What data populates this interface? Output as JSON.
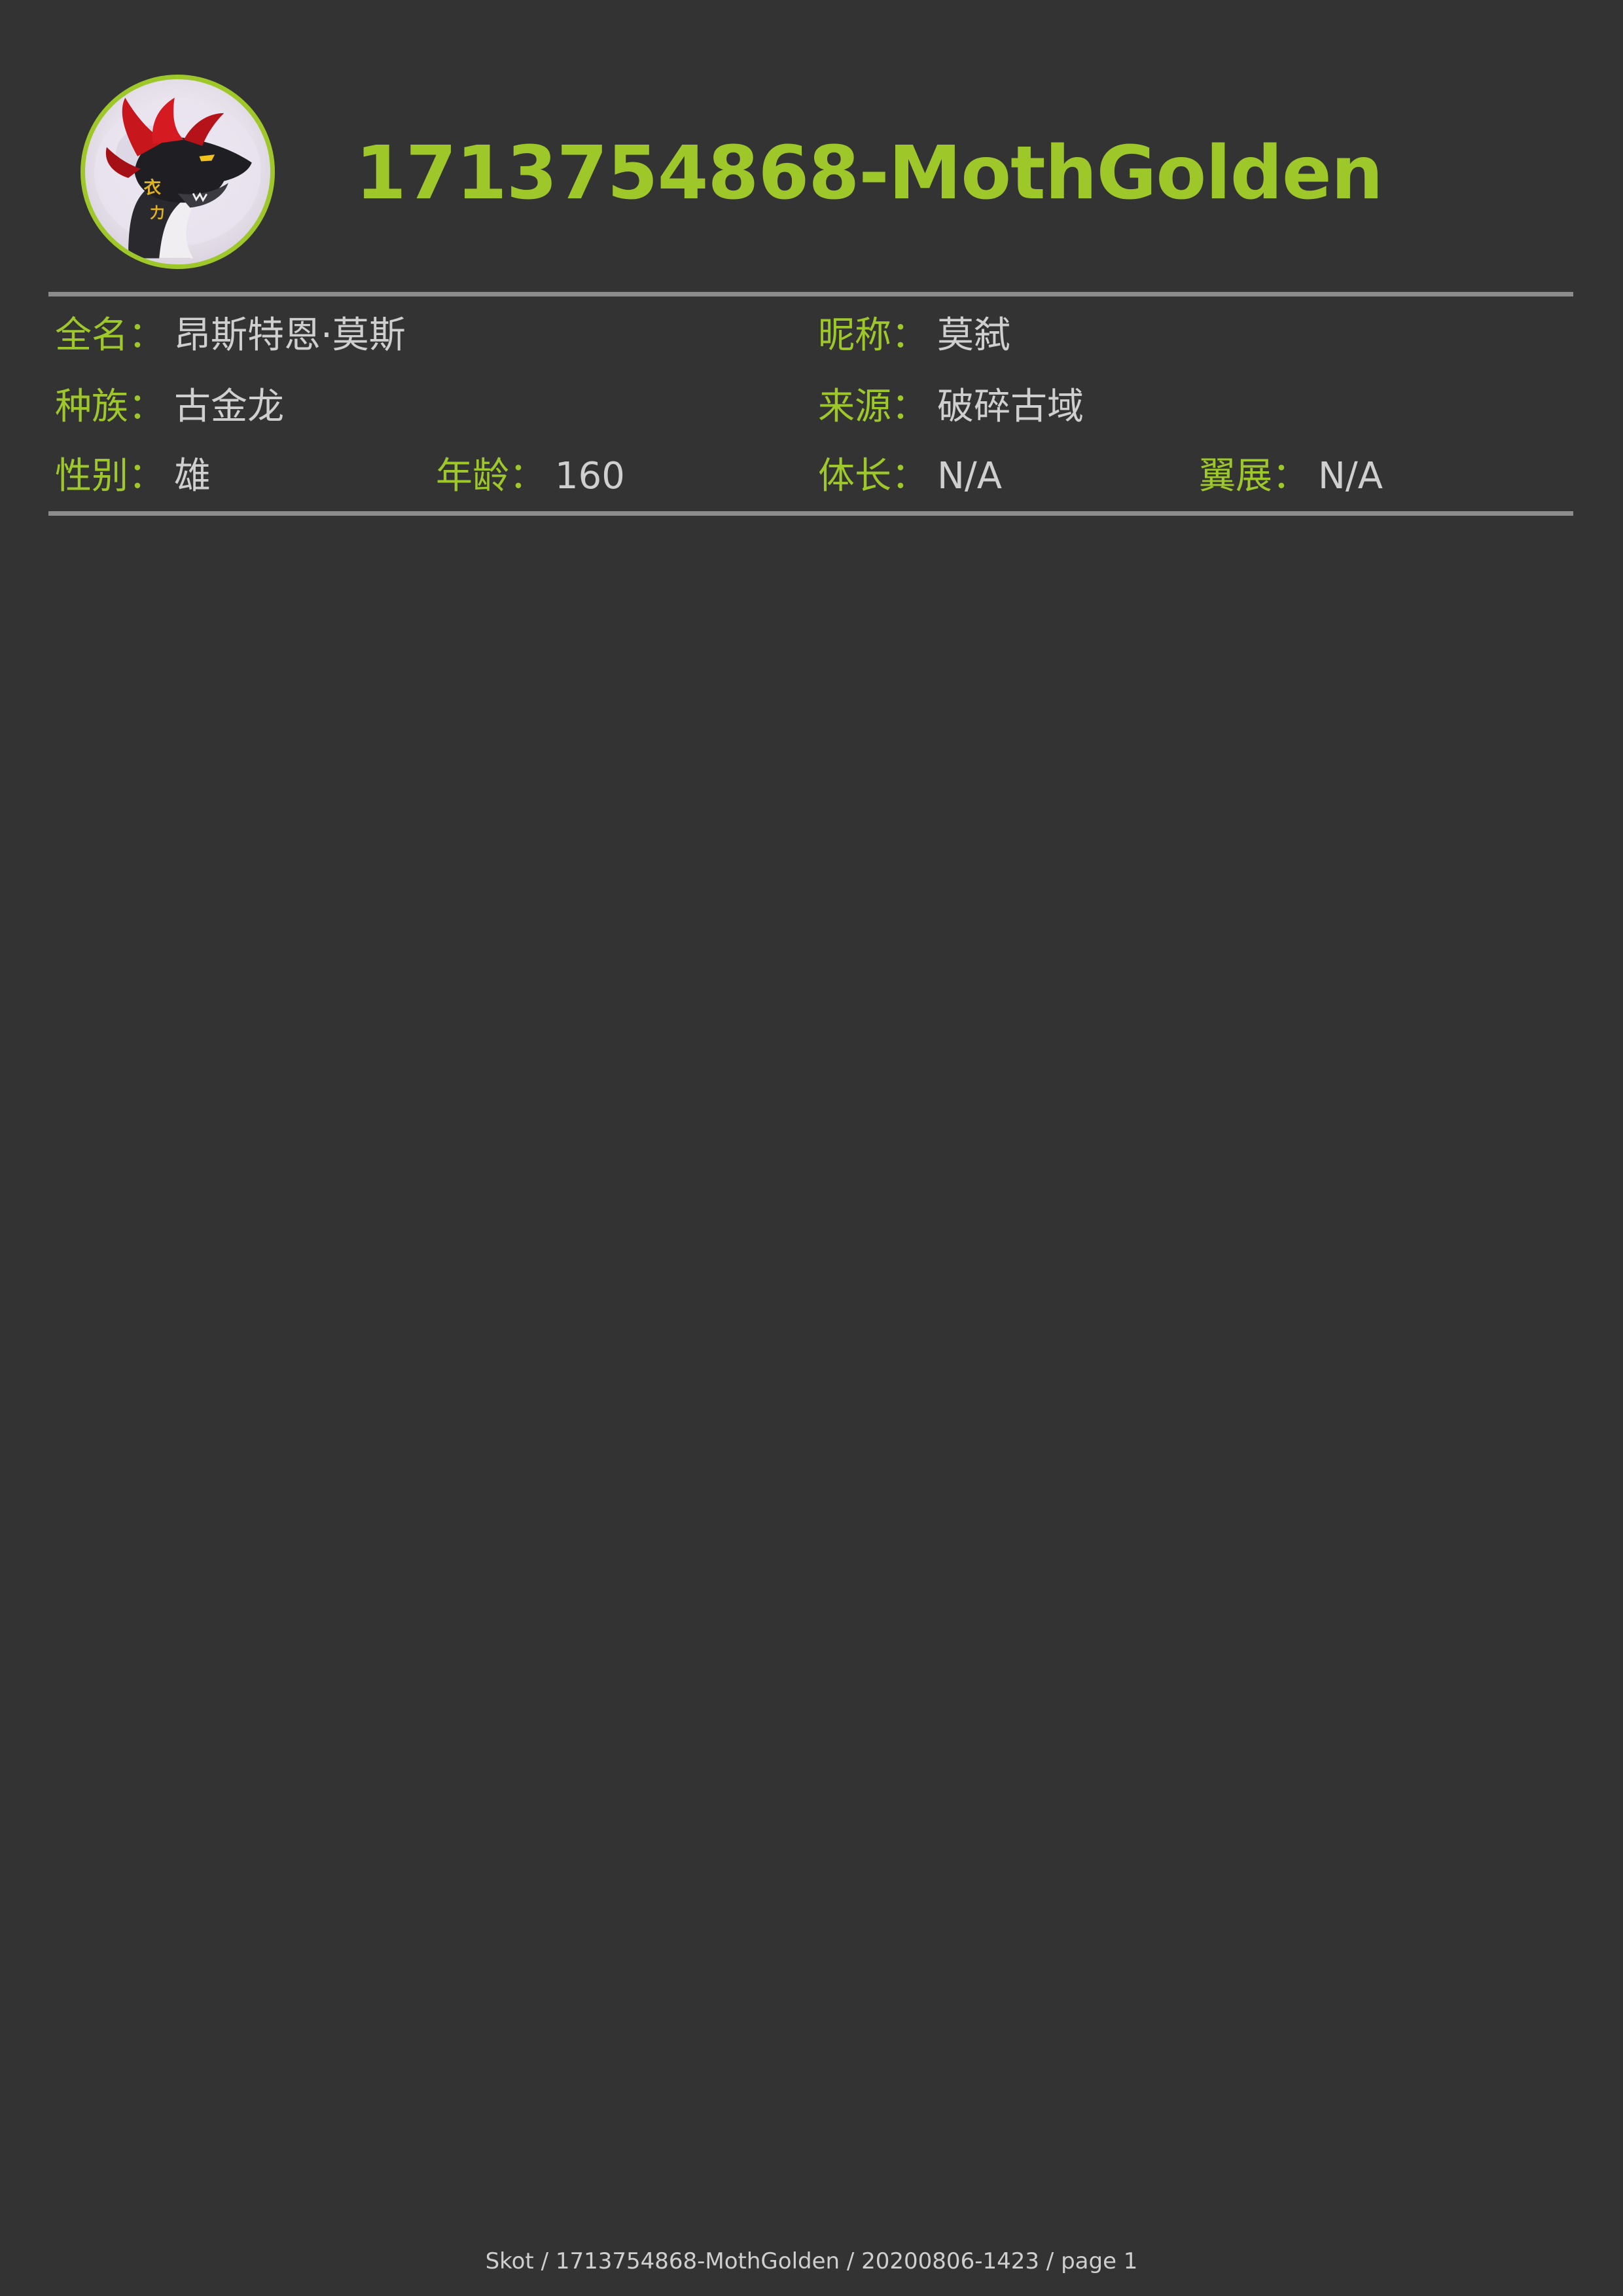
{
  "header": {
    "title": "1713754868-MothGolden",
    "avatar_icon": "dragon-head-avatar",
    "accent_color": "#9ec82a"
  },
  "fields": {
    "full_name": {
      "label": "全名",
      "value": "昂斯特恩·莫斯"
    },
    "nickname": {
      "label": "昵称",
      "value": "莫弑"
    },
    "species": {
      "label": "种族",
      "value": "古金龙"
    },
    "origin": {
      "label": "来源",
      "value": "破碎古域"
    },
    "gender": {
      "label": "性别",
      "value": "雄"
    },
    "age": {
      "label": "年龄",
      "value": "160"
    },
    "body_length": {
      "label": "体长",
      "value": "N/A"
    },
    "wingspan": {
      "label": "翼展",
      "value": "N/A"
    },
    "separator": "："
  },
  "footer": {
    "text": "Skot / 1713754868-MothGolden / 20200806-1423 / page 1"
  }
}
